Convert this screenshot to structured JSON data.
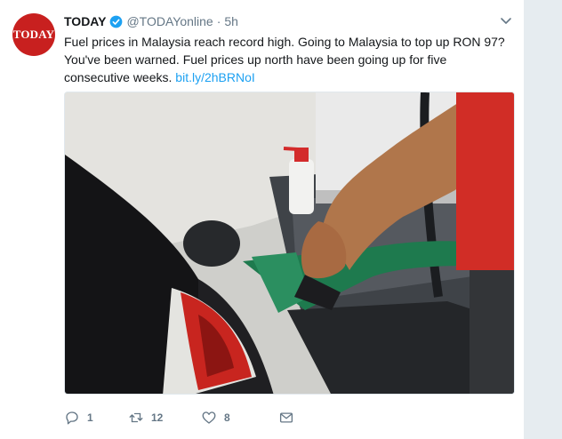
{
  "tweet": {
    "avatar_text": "TODAY",
    "name": "TODAY",
    "handle": "@TODAYonline",
    "separator": "·",
    "time": "5h",
    "text": "Fuel prices in Malaysia reach record high. Going to Malaysia to top up RON 97? You've been warned. Fuel prices up north have been going up for five consecutive weeks.",
    "link": "bit.ly/2hBRNoI",
    "replies": "1",
    "retweets": "12",
    "likes": "8"
  },
  "colors": {
    "brand_red": "#c8201f",
    "link_blue": "#1da1f2",
    "muted": "#657786"
  },
  "icons": [
    "verified-icon",
    "chevron-down-icon",
    "reply-icon",
    "retweet-icon",
    "like-icon",
    "message-icon"
  ]
}
